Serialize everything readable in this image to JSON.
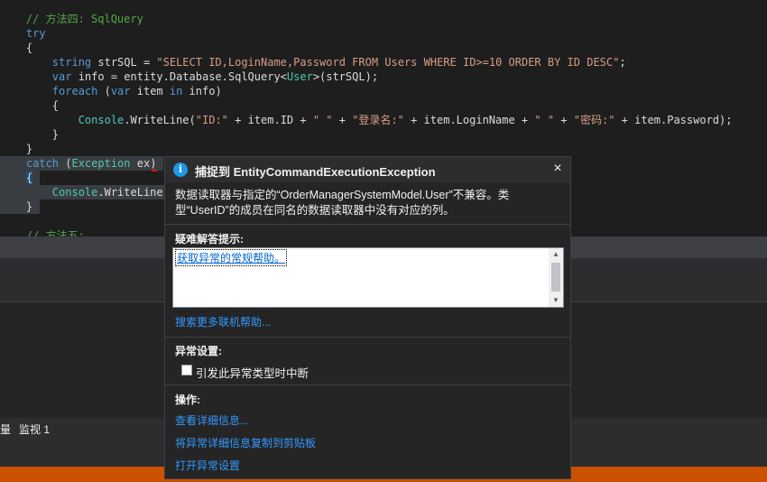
{
  "editor": {
    "lines": [
      {
        "indent": "    ",
        "tokens": [
          {
            "t": "// 方法四: SqlQuery",
            "c": "comment"
          }
        ]
      },
      {
        "indent": "    ",
        "tokens": [
          {
            "t": "try",
            "c": "kw"
          }
        ]
      },
      {
        "indent": "    ",
        "tokens": [
          {
            "t": "{",
            "c": "plain"
          }
        ]
      },
      {
        "indent": "        ",
        "tokens": [
          {
            "t": "string",
            "c": "kw"
          },
          {
            "t": " strSQL = ",
            "c": "plain"
          },
          {
            "t": "\"SELECT ID,LoginName,Password FROM Users WHERE ID>=10 ORDER BY ID DESC\"",
            "c": "str"
          },
          {
            "t": ";",
            "c": "plain"
          }
        ]
      },
      {
        "indent": "        ",
        "tokens": [
          {
            "t": "var",
            "c": "kw"
          },
          {
            "t": " info = entity.Database.SqlQuery<",
            "c": "plain"
          },
          {
            "t": "User",
            "c": "type"
          },
          {
            "t": ">(strSQL);",
            "c": "plain"
          }
        ]
      },
      {
        "indent": "        ",
        "tokens": [
          {
            "t": "foreach",
            "c": "kw"
          },
          {
            "t": " (",
            "c": "plain"
          },
          {
            "t": "var",
            "c": "kw"
          },
          {
            "t": " item ",
            "c": "plain"
          },
          {
            "t": "in",
            "c": "kw"
          },
          {
            "t": " info)",
            "c": "plain"
          }
        ]
      },
      {
        "indent": "        ",
        "tokens": [
          {
            "t": "{",
            "c": "plain"
          }
        ]
      },
      {
        "indent": "            ",
        "tokens": [
          {
            "t": "Console",
            "c": "type"
          },
          {
            "t": ".WriteLine(",
            "c": "plain"
          },
          {
            "t": "\"ID:\"",
            "c": "str"
          },
          {
            "t": " + item.ID + ",
            "c": "plain"
          },
          {
            "t": "\" \"",
            "c": "str"
          },
          {
            "t": " + ",
            "c": "plain"
          },
          {
            "t": "\"登录名:\"",
            "c": "str"
          },
          {
            "t": " + item.LoginName + ",
            "c": "plain"
          },
          {
            "t": "\" \"",
            "c": "str"
          },
          {
            "t": " + ",
            "c": "plain"
          },
          {
            "t": "\"密码:\"",
            "c": "str"
          },
          {
            "t": " + item.Password);",
            "c": "plain"
          }
        ]
      },
      {
        "indent": "        ",
        "tokens": [
          {
            "t": "}",
            "c": "plain"
          }
        ]
      },
      {
        "indent": "    ",
        "tokens": [
          {
            "t": "}",
            "c": "plain"
          }
        ]
      },
      {
        "indent": "    ",
        "tokens": [
          {
            "t": "catch",
            "c": "kw"
          },
          {
            "t": " (",
            "c": "plain"
          },
          {
            "t": "Exception",
            "c": "type"
          },
          {
            "t": " ex)",
            "c": "plain"
          }
        ],
        "highlight": true
      },
      {
        "indent": "    ",
        "tokens": [
          {
            "t": "{",
            "c": "plain"
          }
        ],
        "highlight": true,
        "caret": true
      },
      {
        "indent": "        ",
        "tokens": [
          {
            "t": "Console",
            "c": "type"
          },
          {
            "t": ".WriteLine",
            "c": "plain"
          }
        ],
        "highlight": true
      },
      {
        "indent": "    ",
        "tokens": [
          {
            "t": "}",
            "c": "plain"
          }
        ],
        "highlight": true
      },
      {
        "indent": "",
        "tokens": []
      },
      {
        "indent": "    ",
        "tokens": [
          {
            "t": "// 方法五:",
            "c": "comment"
          }
        ]
      }
    ]
  },
  "bottom_tabs": {
    "tab1": "量",
    "tab2": "监视 1"
  },
  "popup": {
    "title": "捕捉到 EntityCommandExecutionException",
    "message_line1": "数据读取器与指定的“OrderManagerSystemModel.User”不兼容。类",
    "message_line2": "型“UserID”的成员在同名的数据读取器中没有对应的列。",
    "troubleshoot_label": "疑难解答提示:",
    "hint_link": "获取异常的常规帮助。",
    "search_more": "搜索更多联机帮助...",
    "exception_settings_label": "异常设置:",
    "break_checkbox_label": "引发此异常类型时中断",
    "break_checkbox_checked": false,
    "actions_label": "操作:",
    "action_view_detail": "查看详细信息...",
    "action_copy": "将异常详细信息复制到剪贴板",
    "action_open_settings": "打开异常设置",
    "close_glyph": "×",
    "info_glyph": "i",
    "icons": {
      "info": "info-icon",
      "close": "close-icon"
    }
  },
  "colors": {
    "editor_bg": "#1e1e1e",
    "status_bar": "#ca5100",
    "link": "#3399ff",
    "info_icon": "#1c97ea"
  }
}
